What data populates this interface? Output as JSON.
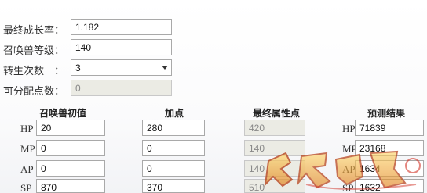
{
  "form": {
    "growth_rate_label": "最终成长率：",
    "growth_rate_value": "1.182",
    "summon_level_label": "召唤兽等级：",
    "summon_level_value": "140",
    "rebirth_label": "转生次数　：",
    "rebirth_value": "3",
    "free_points_label": "可分配点数：",
    "free_points_value": "0"
  },
  "table": {
    "headers": {
      "initial": "召唤兽初值",
      "add": "加点",
      "final": "最终属性点",
      "predict": "预测结果"
    },
    "rows": [
      {
        "label": "HP",
        "initial": "20",
        "add": "280",
        "final": "420",
        "predict_label": "HP",
        "predict": "71839"
      },
      {
        "label": "MP",
        "initial": "0",
        "add": "0",
        "final": "140",
        "predict_label": "MP",
        "predict": "23168"
      },
      {
        "label": "AP",
        "initial": "0",
        "add": "0",
        "final": "140",
        "predict_label": "AP",
        "predict": "1634"
      },
      {
        "label": "SP",
        "initial": "870",
        "add": "370",
        "final": "510",
        "predict_label": "SP",
        "predict": "1632"
      }
    ]
  },
  "colors": {
    "watermark_primary": "#f0a020",
    "watermark_secondary": "#d2352a"
  }
}
